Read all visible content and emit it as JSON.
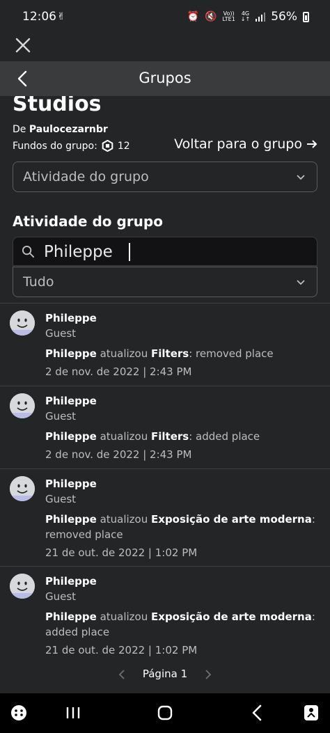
{
  "status_bar": {
    "time": "12:06",
    "network_top": "Vo))",
    "network_bottom": "LTE1",
    "network_type": "4G",
    "battery": "56%"
  },
  "header": {
    "title": "Grupos"
  },
  "group": {
    "name": "Studios",
    "owner_prefix": "De",
    "owner": "Paulocezarnbr",
    "funds_label": "Fundos do grupo:",
    "funds_value": "12",
    "back_to_group": "Voltar para o grupo"
  },
  "section_select": {
    "value": "Atividade do grupo"
  },
  "section_title": "Atividade do grupo",
  "search": {
    "value": "Phileppe"
  },
  "filter_select": {
    "value": "Tudo"
  },
  "entries": [
    {
      "name": "Phileppe",
      "role": "Guest",
      "actor": "Phileppe",
      "verb": "atualizou",
      "target": "Filters",
      "action": ": removed place",
      "date": "2 de nov. de 2022 | 2:43 PM"
    },
    {
      "name": "Phileppe",
      "role": "Guest",
      "actor": "Phileppe",
      "verb": "atualizou",
      "target": "Filters",
      "action": ": added place",
      "date": "2 de nov. de 2022 | 2:43 PM"
    },
    {
      "name": "Phileppe",
      "role": "Guest",
      "actor": "Phileppe",
      "verb": "atualizou",
      "target": "Exposição de arte moderna",
      "action": ": removed place",
      "date": "21 de out. de 2022 | 1:02 PM"
    },
    {
      "name": "Phileppe",
      "role": "Guest",
      "actor": "Phileppe",
      "verb": "atualizou",
      "target": "Exposição de arte moderna",
      "action": ": added place",
      "date": "21 de out. de 2022 | 1:02 PM"
    }
  ],
  "pager": {
    "label": "Página 1"
  },
  "colors": {
    "background": "#232527",
    "header": "#393b3d",
    "secondary_text": "#bdbebe",
    "search_background": "#121215"
  }
}
